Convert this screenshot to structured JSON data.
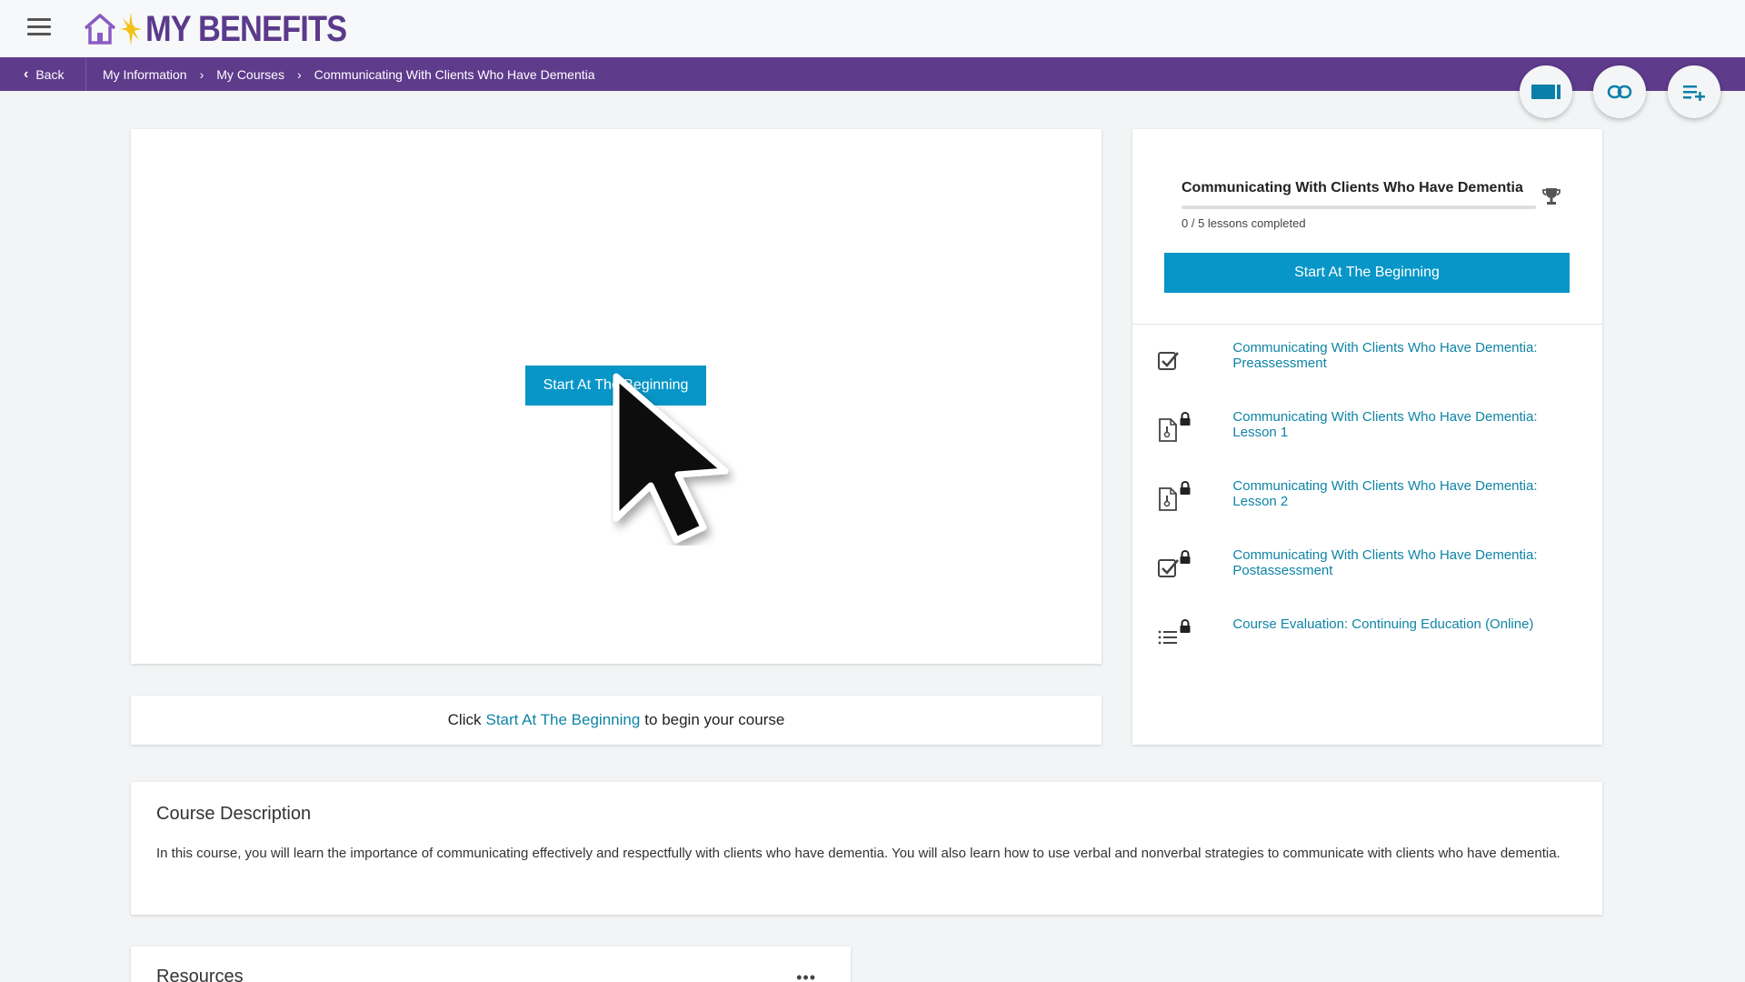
{
  "header": {
    "logo_text": "MY BENEFITS"
  },
  "navbar": {
    "back_label": "Back",
    "breadcrumbs": [
      "My Information",
      "My Courses",
      "Communicating With Clients Who Have Dementia"
    ]
  },
  "player": {
    "start_label": "Start At The Beginning"
  },
  "instruction": {
    "prefix": "Click",
    "link": "Start At The Beginning",
    "suffix": "to begin your course"
  },
  "side": {
    "course_title": "Communicating With Clients Who Have Dementia",
    "progress_text": "0 / 5 lessons completed",
    "progress_fraction": 0,
    "start_label": "Start At The Beginning",
    "lessons": [
      {
        "label": "Communicating With Clients Who Have Dementia: Preassessment",
        "icon": "checklist-icon",
        "locked": false
      },
      {
        "label": "Communicating With Clients Who Have Dementia: Lesson 1",
        "icon": "document-icon",
        "locked": true
      },
      {
        "label": "Communicating With Clients Who Have Dementia: Lesson 2",
        "icon": "document-icon",
        "locked": true
      },
      {
        "label": "Communicating With Clients Who Have Dementia: Postassessment",
        "icon": "checklist-icon",
        "locked": true
      },
      {
        "label": "Course Evaluation: Continuing Education (Online)",
        "icon": "list-icon",
        "locked": true
      }
    ]
  },
  "description": {
    "title": "Course Description",
    "text": "In this course, you will learn the importance of communicating effectively and respectfully with clients who have dementia. You will also learn how to use verbal and nonverbal strategies to communicate with clients who have dementia."
  },
  "resources": {
    "title": "Resources",
    "more": "•••"
  },
  "colors": {
    "brand_purple": "#5f3b8c",
    "accent_blue": "#0796c7",
    "link_blue": "#0f84a6"
  }
}
